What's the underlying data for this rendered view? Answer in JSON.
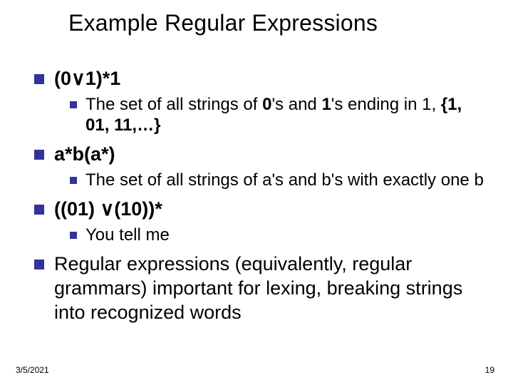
{
  "title": "Example Regular Expressions",
  "items": [
    {
      "expr_html": "(0∨1)*1",
      "sub_html": "The set of all strings of <b>0</b>'s and <b>1</b>'s ending in 1, <b>{1, 01, 11,…}</b>"
    },
    {
      "expr_html": "a*b(a*)",
      "sub_html": "The set of all strings of a's and b's with exactly one b"
    },
    {
      "expr_html": "((01) ∨(10))*",
      "sub_html": "You tell me"
    }
  ],
  "closing": "Regular expressions (equivalently, regular grammars) important for lexing, breaking strings into recognized words",
  "footer": {
    "date": "3/5/2021",
    "page": "19"
  }
}
